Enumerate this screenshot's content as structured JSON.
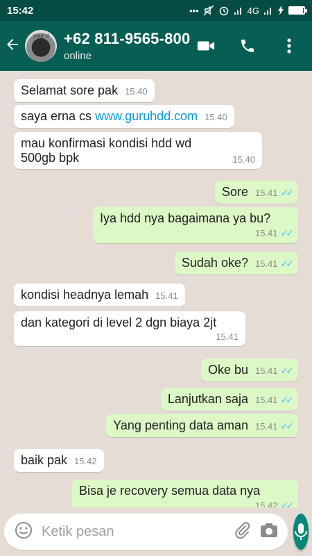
{
  "status_bar": {
    "time": "15:42",
    "network": "4G",
    "icons": [
      "more-dots-icon",
      "mute-icon",
      "alarm-icon",
      "signal-icon",
      "signal-icon",
      "charging-icon",
      "battery-icon"
    ],
    "battery_level": 0.95
  },
  "header": {
    "contact_name": "+62 811-9565-800",
    "contact_status": "online",
    "avatar_text": "your d",
    "colors": {
      "header": "#075e54",
      "status_bar": "#054d44"
    }
  },
  "messages": [
    {
      "direction": "in",
      "text": "Selamat sore pak",
      "time": "15.40"
    },
    {
      "direction": "in",
      "text": "saya erna cs ",
      "link": "www.guruhdd.com",
      "time": "15.40"
    },
    {
      "direction": "in",
      "text": "mau konfirmasi kondisi hdd wd 500gb bpk",
      "time": "15.40"
    },
    {
      "direction": "out",
      "text": "Sore",
      "time": "15.41"
    },
    {
      "direction": "out",
      "text": "Iya hdd nya bagaimana  ya bu?",
      "time": "15.41"
    },
    {
      "direction": "out",
      "text": "Sudah oke?",
      "time": "15.41"
    },
    {
      "direction": "in",
      "text": "kondisi headnya lemah",
      "time": "15.41"
    },
    {
      "direction": "in",
      "text": "dan kategori di level 2 dgn biaya 2jt",
      "time": "15.41"
    },
    {
      "direction": "out",
      "text": "Oke  bu",
      "time": "15.41"
    },
    {
      "direction": "out",
      "text": "Lanjutkan  saja",
      "time": "15.41"
    },
    {
      "direction": "out",
      "text": "Yang penting  data aman",
      "time": "15.41"
    },
    {
      "direction": "in",
      "text": "baik pak",
      "time": "15.42"
    },
    {
      "direction": "out",
      "text": "Bisa je recovery  semua  data  nya",
      "time": "15.42"
    }
  ],
  "input": {
    "placeholder": "Ketik pesan"
  },
  "colors": {
    "outgoing_bubble": "#dcf8c6",
    "incoming_bubble": "#ffffff",
    "read_ticks": "#4fc3f7",
    "mic_button": "#00897b",
    "chat_bg": "#e5ddd5"
  }
}
